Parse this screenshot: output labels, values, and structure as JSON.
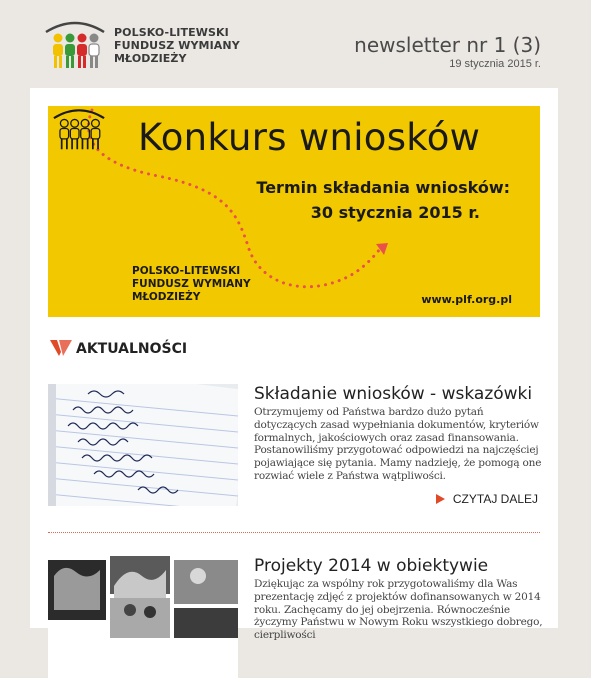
{
  "header": {
    "org_lines": [
      "POLSKO-LITEWSKI",
      "FUNDUSZ WYMIANY",
      "MŁODZIEŻY"
    ],
    "newsletter_title": "newsletter nr 1 (3)",
    "date": "19 stycznia 2015 r."
  },
  "banner": {
    "title": "Konkurs wniosków",
    "subtitle_line1": "Termin składania wniosków:",
    "subtitle_line2": "30 stycznia 2015 r.",
    "org_lines": [
      "POLSKO-LITEWSKI",
      "FUNDUSZ WYMIANY",
      "MŁODZIEŻY"
    ],
    "url": "www.plf.org.pl",
    "bg_color": "#f2c900",
    "accent_color": "#e8524a"
  },
  "section": {
    "title": "AKTUALNOŚCI",
    "icon": "chevron-logo-icon"
  },
  "articles": [
    {
      "title": "Składanie wniosków - wskazówki",
      "text": "Otrzymujemy od Państwa bardzo dużo pytań dotyczących zasad wypełniania dokumentów, kryteriów formalnych, jakościowych oraz zasad finansowania. Postanowiliśmy przygotować odpowiedzi na najczęściej pojawiające się pytania. Mamy nadzieję, że pomogą one rozwiać wiele z Państwa wątpliwości.",
      "read_more": "CZYTAJ DALEJ"
    },
    {
      "title": "Projekty 2014 w obiektywie",
      "text": "Dziękując za wspólny rok przygotowaliśmy dla Was prezentację zdjęć z projektów dofinansowanych w 2014 roku. Zachęcamy do jej obejrzenia. Równocześnie życzymy Państwu w Nowym Roku wszystkiego dobrego, cierpliwości"
    }
  ]
}
